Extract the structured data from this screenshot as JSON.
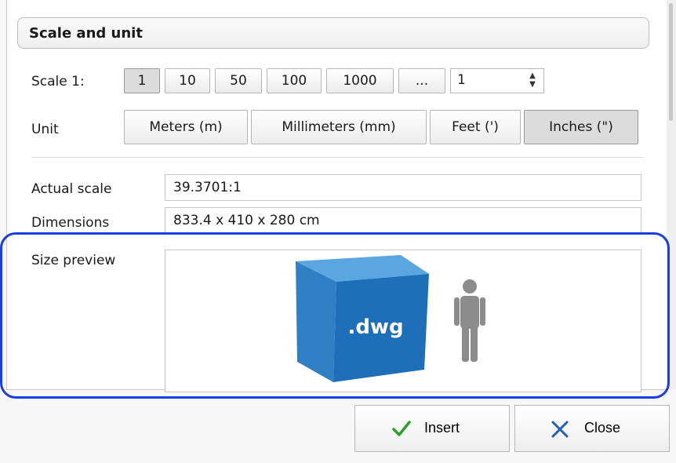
{
  "section": {
    "title": "Scale and unit"
  },
  "scale": {
    "label": "Scale 1:",
    "buttons": [
      "1",
      "10",
      "50",
      "100",
      "1000",
      "..."
    ],
    "selected": "1",
    "spin_value": "1"
  },
  "unit": {
    "label": "Unit",
    "buttons": [
      "Meters (m)",
      "Millimeters (mm)",
      "Feet (')",
      "Inches (\")"
    ],
    "selected": "Inches (\")"
  },
  "info": {
    "actual_scale_label": "Actual scale",
    "actual_scale_value": "39.3701:1",
    "dimensions_label": "Dimensions",
    "dimensions_value": "833.4 x 410 x 280 cm",
    "size_preview_label": "Size preview",
    "cube_text": ".dwg"
  },
  "footer": {
    "insert": "Insert",
    "close": "Close"
  },
  "colors": {
    "highlight": "#1a3fe0",
    "cube_front": "#1c6fb8",
    "cube_side": "#3b8fd2",
    "person": "#8c8c8c",
    "check": "#2e9d2e",
    "close_x": "#1f5fbf"
  },
  "icons": {
    "insert": "checkmark-icon",
    "close": "close-icon",
    "preview_file": "dwg-cube-icon",
    "preview_scale": "person-icon"
  }
}
